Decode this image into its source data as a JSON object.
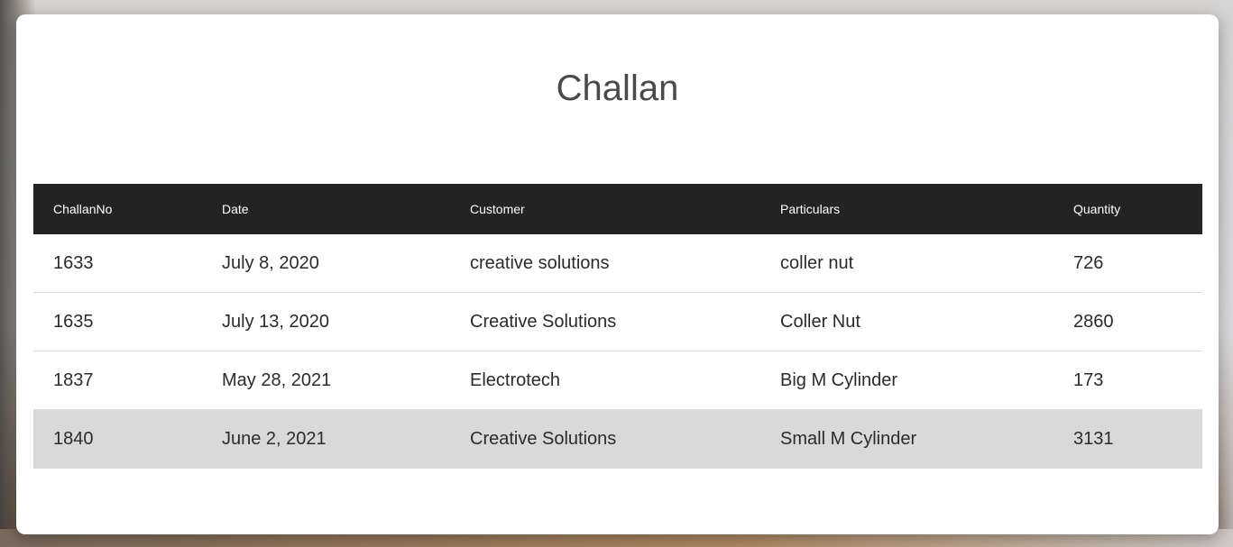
{
  "title": "Challan",
  "table": {
    "columns": [
      "ChallanNo",
      "Date",
      "Customer",
      "Particulars",
      "Quantity"
    ],
    "rows": [
      {
        "challan_no": "1633",
        "date": "July 8, 2020",
        "customer": "creative solutions",
        "particulars": "coller nut",
        "quantity": "726"
      },
      {
        "challan_no": "1635",
        "date": "July 13, 2020",
        "customer": "Creative Solutions",
        "particulars": "Coller Nut",
        "quantity": "2860"
      },
      {
        "challan_no": "1837",
        "date": "May 28, 2021",
        "customer": "Electrotech",
        "particulars": "Big M Cylinder",
        "quantity": "173"
      },
      {
        "challan_no": "1840",
        "date": "June 2, 2021",
        "customer": "Creative Solutions",
        "particulars": "Small M Cylinder",
        "quantity": "3131"
      }
    ],
    "highlighted_row": 3
  },
  "colors": {
    "header_bg": "#232323",
    "highlight_bg": "#d9d9d9",
    "title_color": "#4a4a4a"
  }
}
